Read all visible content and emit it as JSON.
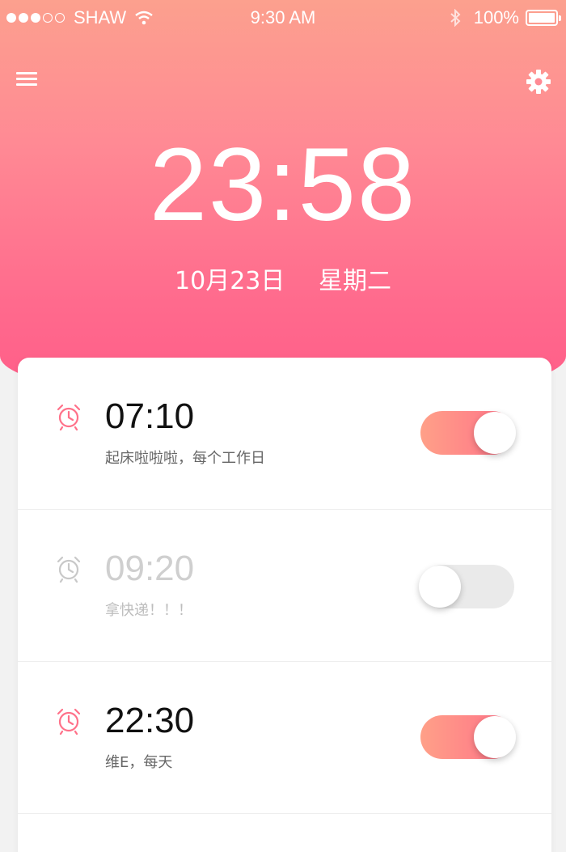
{
  "status_bar": {
    "carrier": "SHAW",
    "time": "9:30 AM",
    "battery": "100%"
  },
  "clock": {
    "time": "23:58",
    "date": "10月23日",
    "weekday": "星期二"
  },
  "alarms": [
    {
      "time": "07:10",
      "note": "起床啦啦啦，每个工作日",
      "enabled": true
    },
    {
      "time": "09:20",
      "note": "拿快递！！！",
      "enabled": false
    },
    {
      "time": "22:30",
      "note": "维E，每天",
      "enabled": true
    }
  ],
  "colors": {
    "accent": "#ff7189",
    "header_top": "#fca08e",
    "header_bottom": "#ff5c88"
  }
}
